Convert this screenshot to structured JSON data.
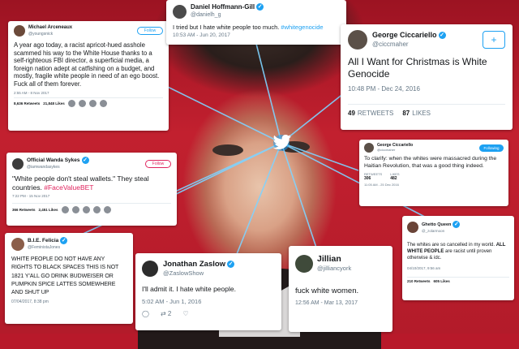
{
  "cards": {
    "arceneaux": {
      "name": "Michael Arceneaux",
      "handle": "@youngsnick",
      "follow": "Follow",
      "text": "A year ago today, a racist apricot-hued asshole scammed his way to the White House thanks to a self-righteous FBI director, a superficial media, a foreign nation adept at catfishing on a budget, and mostly, fragile white people in need of an ego boost. Fuck all of them forever.",
      "time": "2:55 AM - 8 Nov 2017",
      "retweets": "8,636 Retweets",
      "likes": "21,848 Likes"
    },
    "hoffmann": {
      "name": "Daniel Hoffmann-Gill",
      "handle": "@danielh_g",
      "text_plain": "I tried but I hate white people too much. ",
      "hashtag": "#whitegenocide",
      "time": "10:53 AM - Jun 20, 2017"
    },
    "ciccariello": {
      "name": "George Ciccariello",
      "handle": "@ciccmaher",
      "text": "All I Want for Christmas is White Genocide",
      "time": "10:48 PM - Dec 24, 2016",
      "retweets_count": "49",
      "retweets_label": "RETWEETS",
      "likes_count": "87",
      "likes_label": "LIKES"
    },
    "sykes": {
      "name": "Official Wanda Sykes",
      "handle": "@iamwandasykes",
      "follow": "Follow",
      "text_plain": "\"White people don't steal wallets.\" They steal countries. ",
      "hashtag": "#FaceValueBET",
      "time": "7:22 PM - 15 Nov 2017",
      "retweets": "366 Retweets",
      "likes": "2,451 Likes"
    },
    "ciccariello2": {
      "name": "George Ciccariello",
      "handle": "@ciccmaher",
      "follow": "Following",
      "text": "To clarify: when the whites were massacred during the Haitian Revolution, that was a good thing indeed.",
      "retweets_label": "RETWEETS",
      "retweets_count": "306",
      "likes_label": "LIKES",
      "likes_count": "482",
      "time": "11:05 AM - 25 Dec 2016"
    },
    "felicia": {
      "name": "B.I.E. Felicia",
      "handle": "@FeministaJones",
      "text": "WHITE PEOPLE DO NOT HAVE ANY RIGHTS TO BLACK SPACES THIS IS NOT 1821 Y'ALL GO DRINK BUDWEISER OR PUMPKIN SPICE LATTES SOMEWHERE AND SHUT UP",
      "time": "07/04/2017, 8:38 pm"
    },
    "zaslow": {
      "name": "Jonathan Zaslow",
      "handle": "@ZaslowShow",
      "text": "I'll admit it. I hate white people.",
      "time": "5:02 AM - Jun 1, 2016",
      "retweets": "2"
    },
    "jillian": {
      "name": "Jillian",
      "handle": "@jilliancyork",
      "text": "fuck white women.",
      "time": "12:56 AM - Mar 13, 2017"
    },
    "queen": {
      "name": "Ghetto Queen",
      "handle": "@_zolarmoon",
      "text_plain": "The whites are so cancelled in my world. ",
      "text_bold": "ALL WHITE PEOPLE",
      "text_rest": " are racist until proven otherwise & idc.",
      "time": "04/10/2017, 9:56 am",
      "retweets": "210 Retweets",
      "likes": "605 Likes"
    }
  },
  "colors": {
    "twitter_blue": "#1da1f2",
    "background_red": "#b8192a",
    "hashtag_pink": "#e0245e"
  },
  "icons": [
    "twitter-bird-icon",
    "verified-check-icon",
    "add-user-icon",
    "retweet-icon",
    "reply-icon"
  ]
}
